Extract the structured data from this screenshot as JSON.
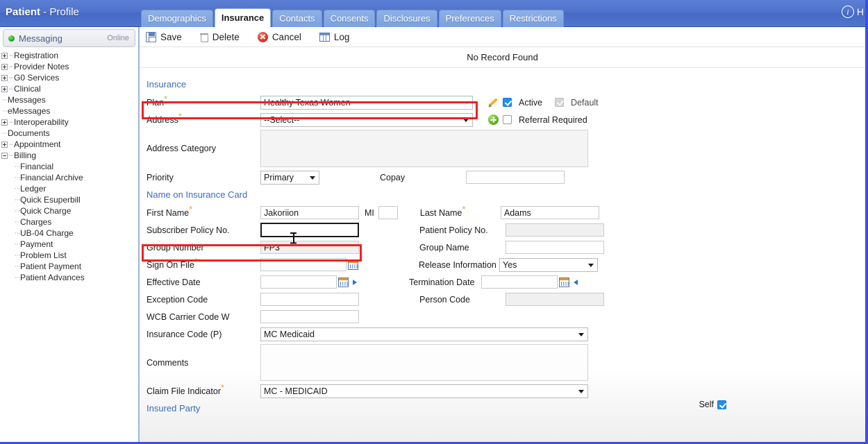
{
  "header": {
    "title_strong": "Patient",
    "title_rest": " - Profile",
    "info_icon": "info-icon",
    "right_partial": "H"
  },
  "sidebar": {
    "messaging": {
      "label": "Messaging",
      "status": "Online",
      "dot": "status-dot-online"
    },
    "items": [
      {
        "label": "Registration",
        "type": "expandable",
        "depth": 0
      },
      {
        "label": "Provider Notes",
        "type": "expandable",
        "depth": 0
      },
      {
        "label": "G0 Services",
        "type": "expandable",
        "depth": 0
      },
      {
        "label": "Clinical",
        "type": "expandable",
        "depth": 0
      },
      {
        "label": "Messages",
        "type": "leaf",
        "depth": 0
      },
      {
        "label": "eMessages",
        "type": "leaf",
        "depth": 0
      },
      {
        "label": "Interoperability",
        "type": "expandable",
        "depth": 0
      },
      {
        "label": "Documents",
        "type": "leaf",
        "depth": 0
      },
      {
        "label": "Appointment",
        "type": "expandable",
        "depth": 0
      },
      {
        "label": "Billing",
        "type": "expanded",
        "depth": 0
      },
      {
        "label": "Financial",
        "type": "leaf",
        "depth": 1
      },
      {
        "label": "Financial Archive",
        "type": "leaf",
        "depth": 1
      },
      {
        "label": "Ledger",
        "type": "leaf",
        "depth": 1
      },
      {
        "label": "Quick Esuperbill",
        "type": "leaf",
        "depth": 1
      },
      {
        "label": "Quick Charge",
        "type": "leaf",
        "depth": 1
      },
      {
        "label": "Charges",
        "type": "leaf",
        "depth": 1
      },
      {
        "label": "UB-04 Charge",
        "type": "leaf",
        "depth": 1
      },
      {
        "label": "Payment",
        "type": "leaf",
        "depth": 1
      },
      {
        "label": "Problem List",
        "type": "leaf",
        "depth": 1
      },
      {
        "label": "Patient Payment",
        "type": "leaf",
        "depth": 1
      },
      {
        "label": "Patient Advances",
        "type": "leaf",
        "depth": 1
      }
    ]
  },
  "tabs": [
    {
      "label": "Demographics",
      "active": false
    },
    {
      "label": "Insurance",
      "active": true
    },
    {
      "label": "Contacts",
      "active": false
    },
    {
      "label": "Consents",
      "active": false
    },
    {
      "label": "Disclosures",
      "active": false
    },
    {
      "label": "Preferences",
      "active": false
    },
    {
      "label": "Restrictions",
      "active": false
    }
  ],
  "toolbar": {
    "save_label": "Save",
    "delete_label": "Delete",
    "cancel_label": "Cancel",
    "log_label": "Log"
  },
  "status": {
    "no_record": "No Record Found"
  },
  "form": {
    "section_insurance": "Insurance",
    "section_name_on_card": "Name on Insurance Card",
    "section_insured_party": "Insured Party",
    "plan": {
      "label": "Plan",
      "required": true,
      "value": "Healthy Texas Women"
    },
    "active": {
      "label": "Active",
      "checked": true
    },
    "default": {
      "label": "Default",
      "checked": true,
      "disabled": true
    },
    "address": {
      "label": "Address",
      "required": true,
      "value": "--Select--"
    },
    "referral_required": {
      "label": "Referral Required",
      "checked": false
    },
    "address_category": {
      "label": "Address Category",
      "value": ""
    },
    "priority": {
      "label": "Priority",
      "value": "Primary"
    },
    "copay": {
      "label": "Copay",
      "value": ""
    },
    "first_name": {
      "label": "First Name",
      "required": true,
      "value": "Jakoriion"
    },
    "mi": {
      "label": "MI",
      "value": ""
    },
    "last_name": {
      "label": "Last Name",
      "required": true,
      "value": "Adams"
    },
    "subscriber_policy_no": {
      "label": "Subscriber Policy No.",
      "value": "",
      "focused": true
    },
    "patient_policy_no": {
      "label": "Patient Policy No.",
      "value": "",
      "readonly": true
    },
    "group_number": {
      "label": "Group Number",
      "value": "FP3",
      "readonly": true
    },
    "group_name": {
      "label": "Group Name",
      "value": ""
    },
    "sign_on_file": {
      "label": "Sign On File",
      "required": true,
      "value": ""
    },
    "release_information": {
      "label": "Release Information",
      "value": "Yes"
    },
    "effective_date": {
      "label": "Effective Date",
      "value": ""
    },
    "termination_date": {
      "label": "Termination Date",
      "value": ""
    },
    "exception_code": {
      "label": "Exception Code",
      "value": ""
    },
    "person_code": {
      "label": "Person Code",
      "value": ""
    },
    "wcb_carrier_code": {
      "label": "WCB Carrier Code W",
      "value": ""
    },
    "insurance_code": {
      "label": "Insurance Code (P)",
      "value": "MC Medicaid"
    },
    "comments": {
      "label": "Comments",
      "value": ""
    },
    "claim_file_indicator": {
      "label": "Claim File Indicator",
      "required": true,
      "value": "MC - MEDICAID"
    },
    "self": {
      "label": "Self",
      "checked": true
    }
  },
  "annotations": {
    "highlight_color": "#ee2222",
    "boxes": [
      "plan-row-highlight",
      "group-number-row-highlight"
    ]
  }
}
